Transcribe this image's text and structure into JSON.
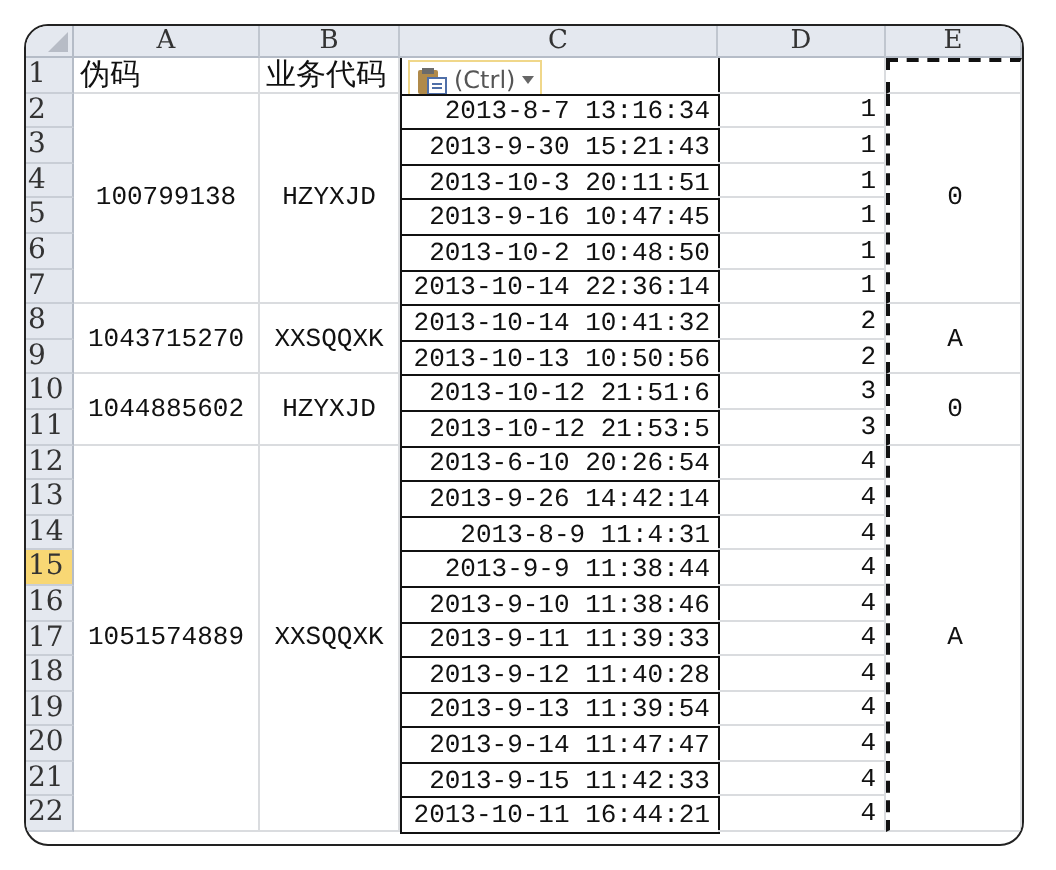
{
  "columns": [
    {
      "label": "A",
      "selected": false
    },
    {
      "label": "B",
      "selected": false
    },
    {
      "label": "C",
      "selected": false
    },
    {
      "label": "D",
      "selected": false
    },
    {
      "label": "E",
      "selected": false
    }
  ],
  "row_headers": [
    {
      "label": "1",
      "selected": false
    },
    {
      "label": "2",
      "selected": false
    },
    {
      "label": "3",
      "selected": false
    },
    {
      "label": "4",
      "selected": false
    },
    {
      "label": "5",
      "selected": false
    },
    {
      "label": "6",
      "selected": false
    },
    {
      "label": "7",
      "selected": false
    },
    {
      "label": "8",
      "selected": false
    },
    {
      "label": "9",
      "selected": false
    },
    {
      "label": "10",
      "selected": false
    },
    {
      "label": "11",
      "selected": false
    },
    {
      "label": "12",
      "selected": false
    },
    {
      "label": "13",
      "selected": false
    },
    {
      "label": "14",
      "selected": false
    },
    {
      "label": "15",
      "selected": true
    },
    {
      "label": "16",
      "selected": false
    },
    {
      "label": "17",
      "selected": false
    },
    {
      "label": "18",
      "selected": false
    },
    {
      "label": "19",
      "selected": false
    },
    {
      "label": "20",
      "selected": false
    },
    {
      "label": "21",
      "selected": false
    },
    {
      "label": "22",
      "selected": false
    }
  ],
  "header": {
    "col_a": "伪码",
    "col_b": "业务代码",
    "paste_options": "(Ctrl)"
  },
  "groups": [
    {
      "pseudo_code": "100799138",
      "business_code": "HZYXJD",
      "flag": "0",
      "entries": [
        {
          "time": "2013-8-7 13:16:34",
          "count": "1"
        },
        {
          "time": "2013-9-30 15:21:43",
          "count": "1"
        },
        {
          "time": "2013-10-3 20:11:51",
          "count": "1"
        },
        {
          "time": "2013-9-16 10:47:45",
          "count": "1"
        },
        {
          "time": "2013-10-2 10:48:50",
          "count": "1"
        },
        {
          "time": "2013-10-14 22:36:14",
          "count": "1"
        }
      ]
    },
    {
      "pseudo_code": "1043715270",
      "business_code": "XXSQQXK",
      "flag": "A",
      "entries": [
        {
          "time": "2013-10-14 10:41:32",
          "count": "2"
        },
        {
          "time": "2013-10-13 10:50:56",
          "count": "2"
        }
      ]
    },
    {
      "pseudo_code": "1044885602",
      "business_code": "HZYXJD",
      "flag": "0",
      "entries": [
        {
          "time": "2013-10-12 21:51:6",
          "count": "3"
        },
        {
          "time": "2013-10-12 21:53:5",
          "count": "3"
        }
      ]
    },
    {
      "pseudo_code": "1051574889",
      "business_code": "XXSQQXK",
      "flag": "A",
      "entries": [
        {
          "time": "2013-6-10 20:26:54",
          "count": "4"
        },
        {
          "time": "2013-9-26 14:42:14",
          "count": "4"
        },
        {
          "time": "2013-8-9 11:4:31",
          "count": "4"
        },
        {
          "time": "2013-9-9 11:38:44",
          "count": "4"
        },
        {
          "time": "2013-9-10 11:38:46",
          "count": "4"
        },
        {
          "time": "2013-9-11 11:39:33",
          "count": "4"
        },
        {
          "time": "2013-9-12 11:40:28",
          "count": "4"
        },
        {
          "time": "2013-9-13 11:39:54",
          "count": "4"
        },
        {
          "time": "2013-9-14 11:47:47",
          "count": "4"
        },
        {
          "time": "2013-9-15 11:42:33",
          "count": "4"
        },
        {
          "time": "2013-10-11 16:44:21",
          "count": "4"
        }
      ]
    }
  ]
}
